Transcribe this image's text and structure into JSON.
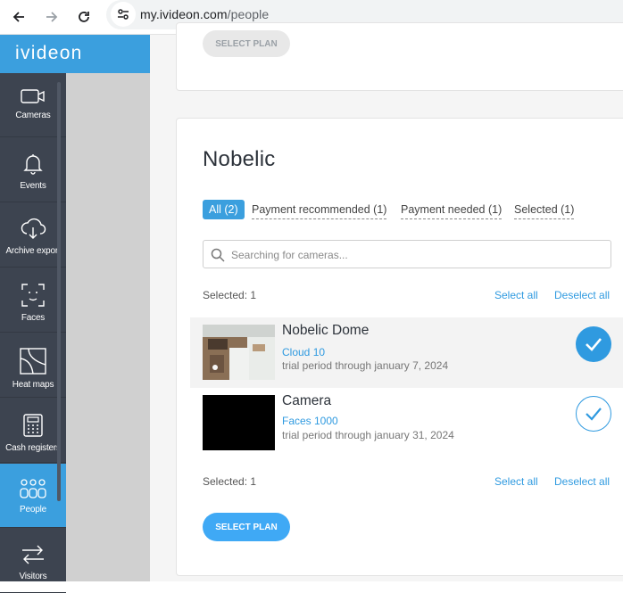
{
  "browser": {
    "url_host": "my.ivideon.com",
    "url_path": "/people"
  },
  "brand": {
    "name": "ivideon"
  },
  "nav": {
    "items": [
      {
        "label": "Cameras",
        "icon": "camera-icon"
      },
      {
        "label": "Events",
        "icon": "bell-icon"
      },
      {
        "label": "Archive export",
        "icon": "cloud-download-icon"
      },
      {
        "label": "Faces",
        "icon": "face-scan-icon"
      },
      {
        "label": "Heat maps",
        "icon": "heat-map-icon"
      },
      {
        "label": "Cash registers",
        "icon": "cash-register-icon"
      },
      {
        "label": "People",
        "icon": "people-icon",
        "active": true
      },
      {
        "label": "Visitors",
        "icon": "visitors-arrows-icon"
      }
    ]
  },
  "top_card": {
    "select_plan_label": "SELECT PLAN"
  },
  "card": {
    "title": "Nobelic",
    "tabs": [
      {
        "label": "All (2)",
        "active": true
      },
      {
        "label": "Payment recommended (1)"
      },
      {
        "label": "Payment needed (1)"
      },
      {
        "label": "Selected (1)"
      }
    ],
    "search": {
      "placeholder": "Searching for cameras..."
    },
    "selected_label": "Selected: 1",
    "select_all": "Select all",
    "deselect_all": "Deselect all",
    "cameras": [
      {
        "name": "Nobelic Dome",
        "plan": "Cloud 10",
        "trial": "trial period through january 7, 2024",
        "selected": true
      },
      {
        "name": "Camera",
        "plan": "Faces 1000",
        "trial": "trial period through january 31, 2024",
        "selected": false
      }
    ],
    "select_plan_label": "SELECT PLAN"
  },
  "colors": {
    "accent": "#3b9fde",
    "sidebar": "#3d4450",
    "link": "#2f9ae0"
  }
}
